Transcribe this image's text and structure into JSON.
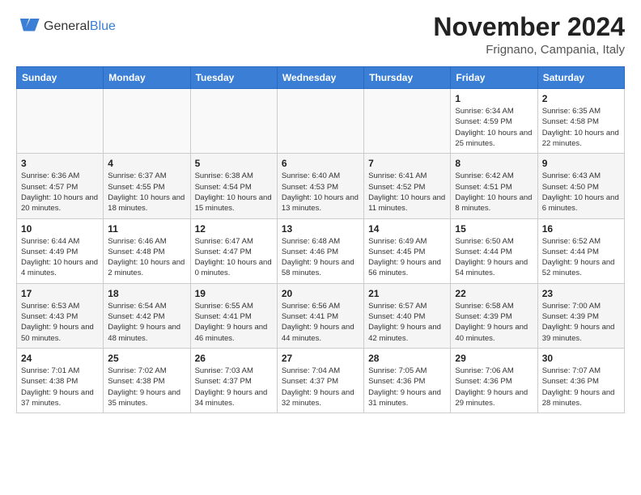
{
  "header": {
    "logo_line1": "General",
    "logo_line2": "Blue",
    "month_title": "November 2024",
    "location": "Frignano, Campania, Italy"
  },
  "weekdays": [
    "Sunday",
    "Monday",
    "Tuesday",
    "Wednesday",
    "Thursday",
    "Friday",
    "Saturday"
  ],
  "weeks": [
    [
      {
        "day": "",
        "info": ""
      },
      {
        "day": "",
        "info": ""
      },
      {
        "day": "",
        "info": ""
      },
      {
        "day": "",
        "info": ""
      },
      {
        "day": "",
        "info": ""
      },
      {
        "day": "1",
        "info": "Sunrise: 6:34 AM\nSunset: 4:59 PM\nDaylight: 10 hours and 25 minutes."
      },
      {
        "day": "2",
        "info": "Sunrise: 6:35 AM\nSunset: 4:58 PM\nDaylight: 10 hours and 22 minutes."
      }
    ],
    [
      {
        "day": "3",
        "info": "Sunrise: 6:36 AM\nSunset: 4:57 PM\nDaylight: 10 hours and 20 minutes."
      },
      {
        "day": "4",
        "info": "Sunrise: 6:37 AM\nSunset: 4:55 PM\nDaylight: 10 hours and 18 minutes."
      },
      {
        "day": "5",
        "info": "Sunrise: 6:38 AM\nSunset: 4:54 PM\nDaylight: 10 hours and 15 minutes."
      },
      {
        "day": "6",
        "info": "Sunrise: 6:40 AM\nSunset: 4:53 PM\nDaylight: 10 hours and 13 minutes."
      },
      {
        "day": "7",
        "info": "Sunrise: 6:41 AM\nSunset: 4:52 PM\nDaylight: 10 hours and 11 minutes."
      },
      {
        "day": "8",
        "info": "Sunrise: 6:42 AM\nSunset: 4:51 PM\nDaylight: 10 hours and 8 minutes."
      },
      {
        "day": "9",
        "info": "Sunrise: 6:43 AM\nSunset: 4:50 PM\nDaylight: 10 hours and 6 minutes."
      }
    ],
    [
      {
        "day": "10",
        "info": "Sunrise: 6:44 AM\nSunset: 4:49 PM\nDaylight: 10 hours and 4 minutes."
      },
      {
        "day": "11",
        "info": "Sunrise: 6:46 AM\nSunset: 4:48 PM\nDaylight: 10 hours and 2 minutes."
      },
      {
        "day": "12",
        "info": "Sunrise: 6:47 AM\nSunset: 4:47 PM\nDaylight: 10 hours and 0 minutes."
      },
      {
        "day": "13",
        "info": "Sunrise: 6:48 AM\nSunset: 4:46 PM\nDaylight: 9 hours and 58 minutes."
      },
      {
        "day": "14",
        "info": "Sunrise: 6:49 AM\nSunset: 4:45 PM\nDaylight: 9 hours and 56 minutes."
      },
      {
        "day": "15",
        "info": "Sunrise: 6:50 AM\nSunset: 4:44 PM\nDaylight: 9 hours and 54 minutes."
      },
      {
        "day": "16",
        "info": "Sunrise: 6:52 AM\nSunset: 4:44 PM\nDaylight: 9 hours and 52 minutes."
      }
    ],
    [
      {
        "day": "17",
        "info": "Sunrise: 6:53 AM\nSunset: 4:43 PM\nDaylight: 9 hours and 50 minutes."
      },
      {
        "day": "18",
        "info": "Sunrise: 6:54 AM\nSunset: 4:42 PM\nDaylight: 9 hours and 48 minutes."
      },
      {
        "day": "19",
        "info": "Sunrise: 6:55 AM\nSunset: 4:41 PM\nDaylight: 9 hours and 46 minutes."
      },
      {
        "day": "20",
        "info": "Sunrise: 6:56 AM\nSunset: 4:41 PM\nDaylight: 9 hours and 44 minutes."
      },
      {
        "day": "21",
        "info": "Sunrise: 6:57 AM\nSunset: 4:40 PM\nDaylight: 9 hours and 42 minutes."
      },
      {
        "day": "22",
        "info": "Sunrise: 6:58 AM\nSunset: 4:39 PM\nDaylight: 9 hours and 40 minutes."
      },
      {
        "day": "23",
        "info": "Sunrise: 7:00 AM\nSunset: 4:39 PM\nDaylight: 9 hours and 39 minutes."
      }
    ],
    [
      {
        "day": "24",
        "info": "Sunrise: 7:01 AM\nSunset: 4:38 PM\nDaylight: 9 hours and 37 minutes."
      },
      {
        "day": "25",
        "info": "Sunrise: 7:02 AM\nSunset: 4:38 PM\nDaylight: 9 hours and 35 minutes."
      },
      {
        "day": "26",
        "info": "Sunrise: 7:03 AM\nSunset: 4:37 PM\nDaylight: 9 hours and 34 minutes."
      },
      {
        "day": "27",
        "info": "Sunrise: 7:04 AM\nSunset: 4:37 PM\nDaylight: 9 hours and 32 minutes."
      },
      {
        "day": "28",
        "info": "Sunrise: 7:05 AM\nSunset: 4:36 PM\nDaylight: 9 hours and 31 minutes."
      },
      {
        "day": "29",
        "info": "Sunrise: 7:06 AM\nSunset: 4:36 PM\nDaylight: 9 hours and 29 minutes."
      },
      {
        "day": "30",
        "info": "Sunrise: 7:07 AM\nSunset: 4:36 PM\nDaylight: 9 hours and 28 minutes."
      }
    ]
  ]
}
